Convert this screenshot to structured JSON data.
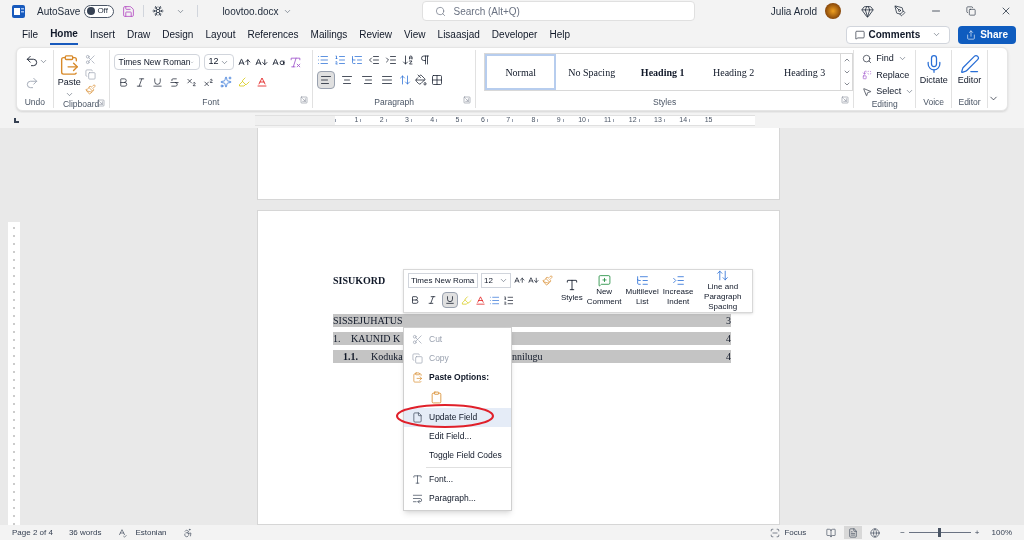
{
  "title_bar": {
    "autosave_label": "AutoSave",
    "autosave": {
      "label": "Off",
      "on": false
    },
    "file_name": "loovtoo.docx",
    "search_placeholder": "Search (Alt+Q)",
    "user_name": "Julia Arold"
  },
  "menu_tabs": [
    {
      "label": "File",
      "selected": false
    },
    {
      "label": "Home",
      "selected": true
    },
    {
      "label": "Insert",
      "selected": false
    },
    {
      "label": "Draw",
      "selected": false
    },
    {
      "label": "Design",
      "selected": false
    },
    {
      "label": "Layout",
      "selected": false
    },
    {
      "label": "References",
      "selected": false
    },
    {
      "label": "Mailings",
      "selected": false
    },
    {
      "label": "Review",
      "selected": false
    },
    {
      "label": "View",
      "selected": false
    },
    {
      "label": "Lisaasjad",
      "selected": false
    },
    {
      "label": "Developer",
      "selected": false
    },
    {
      "label": "Help",
      "selected": false
    }
  ],
  "comments_button": "Comments",
  "share_button": "Share",
  "ribbon": {
    "undo": {
      "label": "Undo"
    },
    "clipboard": {
      "paste": "Paste",
      "label": "Clipboard"
    },
    "font": {
      "font_name": "Times New Roman",
      "font_size": "12",
      "label": "Font"
    },
    "paragraph": {
      "alignments": [
        {
          "kind": "left",
          "selected": true
        },
        {
          "kind": "center",
          "selected": false
        },
        {
          "kind": "right",
          "selected": false
        },
        {
          "kind": "justify",
          "selected": false
        }
      ],
      "label": "Paragraph"
    },
    "styles": {
      "items": [
        {
          "label": "Normal",
          "selected": true,
          "bold": false
        },
        {
          "label": "No Spacing",
          "selected": false,
          "bold": false
        },
        {
          "label": "Heading 1",
          "selected": false,
          "bold": true
        },
        {
          "label": "Heading 2",
          "selected": false,
          "bold": false
        },
        {
          "label": "Heading 3",
          "selected": false,
          "bold": false
        }
      ],
      "label": "Styles"
    },
    "editing": {
      "find": "Find",
      "replace": "Replace",
      "select": "Select",
      "label": "Editing"
    },
    "voice": {
      "dictate": "Dictate",
      "label": "Voice"
    },
    "editor": {
      "button": "Editor",
      "label": "Editor"
    }
  },
  "ruler": {
    "numbers": [
      "1",
      "2",
      "3",
      "4",
      "5",
      "6",
      "7",
      "8",
      "9",
      "10",
      "11",
      "12",
      "13",
      "14",
      "15"
    ]
  },
  "document": {
    "heading": "SISUKORD",
    "toc": [
      {
        "text": "SISSEJUHATUS",
        "page": "3"
      },
      {
        "number": "1.",
        "text": "KAUNID K",
        "page": "4",
        "children": [
          {
            "number": "1.1.",
            "text": "Koduka",
            "text_after_menu": "nnilugu",
            "page": "4"
          }
        ]
      }
    ],
    "mini_toolbar": {
      "font_name": "Times New Roma",
      "font_size": "12",
      "format": [
        {
          "kind": "bold",
          "selected": false
        },
        {
          "kind": "italic",
          "selected": false
        },
        {
          "kind": "underline",
          "selected": true
        }
      ],
      "buttons": [
        {
          "kind": "comment",
          "label": "New Comment"
        },
        {
          "kind": "multilevel",
          "label": "Multilevel List"
        },
        {
          "kind": "indent",
          "label": "Increase Indent"
        },
        {
          "kind": "spacing",
          "label": "Line and Paragraph Spacing"
        }
      ],
      "styles_label": "Styles"
    },
    "context_menu": {
      "items": [
        {
          "kind": "cut",
          "label": "Cut",
          "disabled": true,
          "selected": false
        },
        {
          "kind": "copy",
          "label": "Copy",
          "disabled": true,
          "selected": false
        },
        {
          "kind": "header",
          "label": "Paste Options:"
        },
        {
          "kind": "paste"
        },
        {
          "kind": "update",
          "label": "Update Field",
          "disabled": false,
          "selected": true
        },
        {
          "kind": "edit",
          "label": "Edit Field...",
          "disabled": false,
          "selected": false
        },
        {
          "kind": "toggle",
          "label": "Toggle Field Codes",
          "disabled": false,
          "selected": false
        },
        {
          "kind": "separator"
        },
        {
          "kind": "font",
          "label": "Font...",
          "disabled": false,
          "selected": false
        },
        {
          "kind": "paragraph",
          "label": "Paragraph...",
          "disabled": false,
          "selected": false
        }
      ]
    },
    "annotation": {
      "kind": "ellipse",
      "color": "#e0202a"
    }
  },
  "status_bar": {
    "page": "Page 2 of 4",
    "words": "36 words",
    "language": "Estonian",
    "focus": "Focus",
    "views": [
      {
        "kind": "read",
        "selected": false
      },
      {
        "kind": "print",
        "selected": true
      },
      {
        "kind": "web",
        "selected": false
      }
    ],
    "zoom_out": "−",
    "zoom_in": "+",
    "zoom": {
      "level": 0.47
    },
    "zoom_percent": "100%"
  }
}
